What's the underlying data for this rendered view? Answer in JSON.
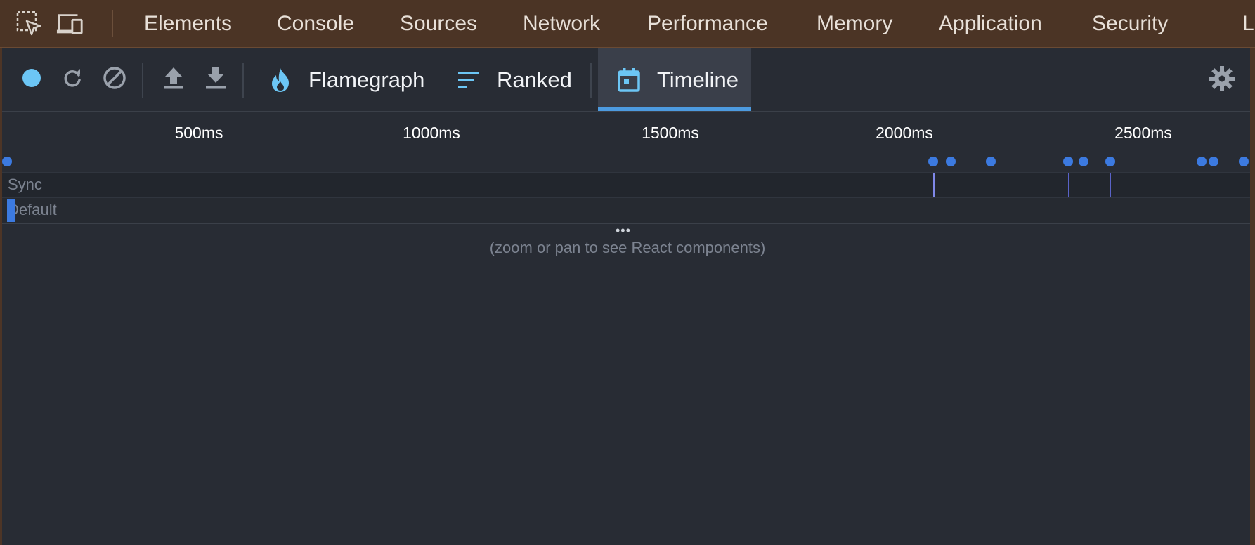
{
  "devtools": {
    "tabs": [
      {
        "label": "Elements"
      },
      {
        "label": "Console"
      },
      {
        "label": "Sources"
      },
      {
        "label": "Network"
      },
      {
        "label": "Performance"
      },
      {
        "label": "Memory"
      },
      {
        "label": "Application"
      },
      {
        "label": "Security"
      },
      {
        "label": "L"
      }
    ]
  },
  "toolbar": {
    "icons": [
      "record-icon",
      "reload-icon",
      "clear-icon",
      "upload-icon",
      "download-icon",
      "gear-icon"
    ],
    "views": [
      {
        "label": "Flamegraph",
        "icon": "flame-icon",
        "active": false
      },
      {
        "label": "Ranked",
        "icon": "ranked-bars-icon",
        "active": false
      },
      {
        "label": "Timeline",
        "icon": "calendar-icon",
        "active": true
      }
    ]
  },
  "timeline": {
    "ticks": [
      "500ms",
      "1000ms",
      "1500ms",
      "2000ms",
      "2500ms"
    ],
    "lanes": [
      {
        "label": "Sync"
      },
      {
        "label": "Default"
      }
    ],
    "ellipsis": "•••",
    "hint": "(zoom or pan to see React components)"
  },
  "colors": {
    "devtools_bg": "#4b3425",
    "panel_bg": "#282c34",
    "accent_blue": "#4d9be0",
    "marker_blue": "#3c7ae0",
    "record_cyan": "#6cc6f5"
  }
}
